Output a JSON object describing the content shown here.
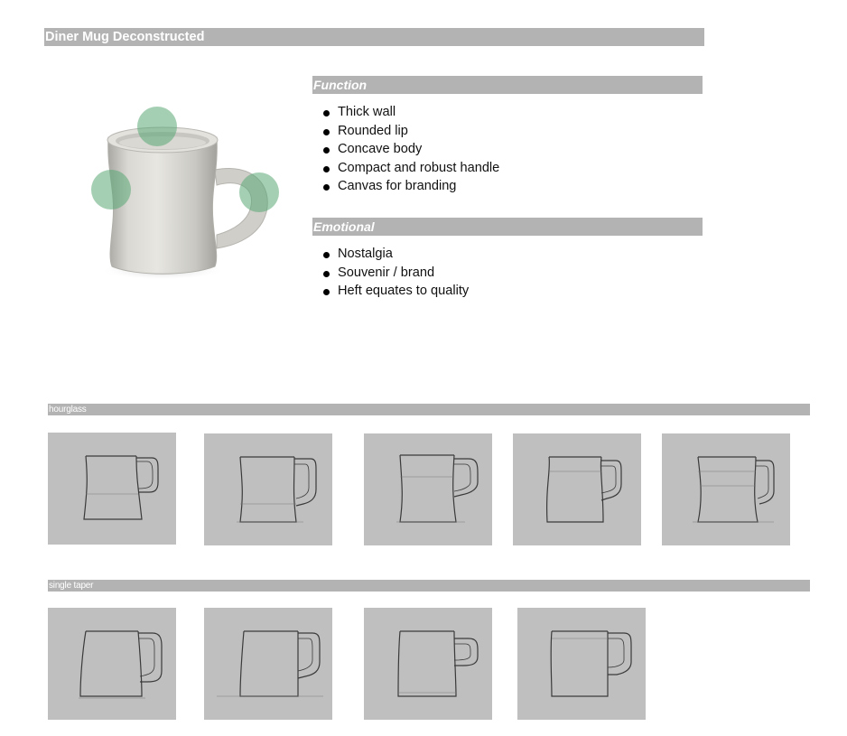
{
  "title": "Diner Mug Deconstructed",
  "function": {
    "heading": "Function",
    "items": [
      "Thick wall",
      "Rounded lip",
      "Concave body",
      "Compact and robust handle",
      "Canvas for branding"
    ]
  },
  "emotional": {
    "heading": "Emotional",
    "items": [
      "Nostalgia",
      "Souvenir / brand",
      "Heft equates to quality"
    ]
  },
  "groups": [
    {
      "label": "hourglass",
      "sketch_count": 5
    },
    {
      "label": "single taper",
      "sketch_count": 4
    }
  ],
  "colors": {
    "header_bar": "#b3b3b3",
    "header_text": "#ffffff",
    "thumbnail_bg": "#bfbfbf",
    "highlight_circle": "#5aa874",
    "mug": "#d6d5cf"
  }
}
